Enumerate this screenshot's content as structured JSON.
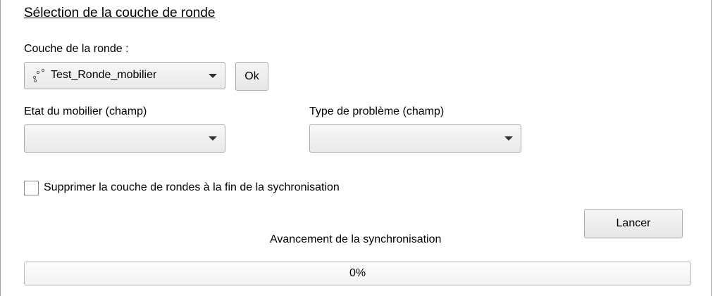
{
  "title": "Sélection de la couche de ronde",
  "layer": {
    "label": "Couche de la ronde :",
    "selected": "Test_Ronde_mobilier",
    "icon": "point-layer-icon",
    "ok_label": "Ok"
  },
  "state_field": {
    "label": "Etat du mobilier (champ)",
    "selected": ""
  },
  "problem_field": {
    "label": "Type de problème (champ)",
    "selected": ""
  },
  "delete_option": {
    "label": "Supprimer la couche de rondes à la fin de la sychronisation",
    "checked": false
  },
  "launch_label": "Lancer",
  "progress": {
    "label": "Avancement de la synchronisation",
    "value_text": "0%",
    "value": 0
  }
}
